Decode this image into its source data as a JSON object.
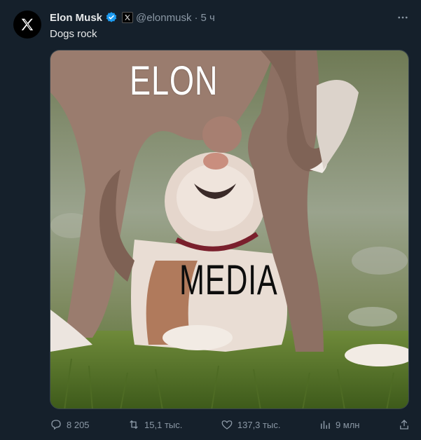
{
  "author": {
    "name": "Elon Musk",
    "handle": "@elonmusk",
    "separator": "·",
    "time": "5 ч"
  },
  "tweet": {
    "text": "Dogs rock"
  },
  "media": {
    "caption_top": "ELON",
    "caption_bottom": "MEDIA"
  },
  "actions": {
    "replies": "8 205",
    "reposts": "15,1 тыс.",
    "likes": "137,3 тыс.",
    "views": "9 млн"
  },
  "colors": {
    "background": "#15202b",
    "accent": "#1d9bf0",
    "muted": "#8b98a5"
  },
  "icons": [
    "x-logo-icon",
    "verified-badge-icon",
    "x-affiliate-icon",
    "more-icon",
    "reply-icon",
    "repost-icon",
    "like-icon",
    "views-icon",
    "share-icon"
  ]
}
